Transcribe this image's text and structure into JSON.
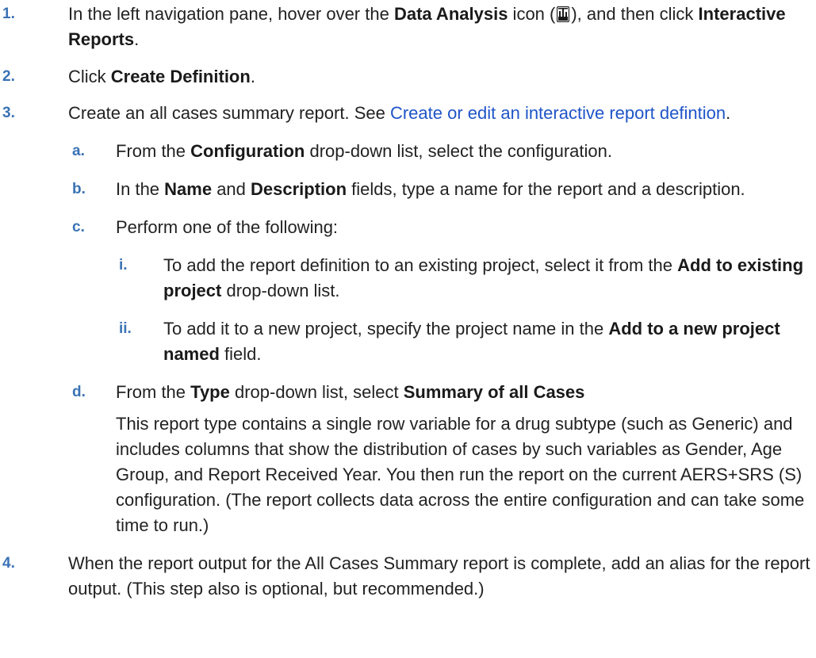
{
  "steps": [
    {
      "num": "1.",
      "parts": [
        "In the left navigation pane, hover over the ",
        "Data Analysis",
        " icon (",
        "), and then click ",
        "Interactive Reports",
        "."
      ]
    },
    {
      "num": "2.",
      "parts": [
        "Click ",
        "Create Definition",
        "."
      ]
    },
    {
      "num": "3.",
      "parts": [
        "Create an all cases summary report. See ",
        "Create or edit an interactive report defintion",
        "."
      ]
    },
    {
      "num": "4.",
      "parts": [
        "When the report output for the All Cases Summary report is complete, add an alias for the report output. (This step also is optional, but recommended.)"
      ]
    }
  ],
  "substeps": {
    "a": {
      "num": "a.",
      "parts": [
        "From the ",
        "Configuration",
        " drop-down list, select the configuration."
      ]
    },
    "b": {
      "num": "b.",
      "parts": [
        "In the ",
        "Name",
        " and ",
        "Description",
        " fields, type a name for the report and a description."
      ]
    },
    "c": {
      "num": "c.",
      "parts": [
        "Perform one of the following:"
      ]
    },
    "i": {
      "num": "i.",
      "parts": [
        "To add the report definition to an existing project, select it from the ",
        "Add to existing project",
        " drop-down list."
      ]
    },
    "ii": {
      "num": "ii.",
      "parts": [
        "To add it to a new project, specify the project name in the ",
        "Add to a new project named",
        " field."
      ]
    },
    "d": {
      "num": "d.",
      "parts": [
        "From the ",
        "Type",
        " drop-down list, select ",
        "Summary of all Cases"
      ],
      "para": "This report type contains a single row variable for a drug subtype (such as Generic) and includes columns that show the distribution of cases by such variables as Gender, Age Group, and Report Received Year. You then run the report on the current AERS+SRS (S) configuration. (The report collects data across the entire configuration and can take some time to run.)"
    }
  },
  "icons": {
    "data_analysis": "data-analysis-icon"
  },
  "colors": {
    "number": "#3a73b5",
    "link": "#1f55c8",
    "text": "#222222"
  }
}
